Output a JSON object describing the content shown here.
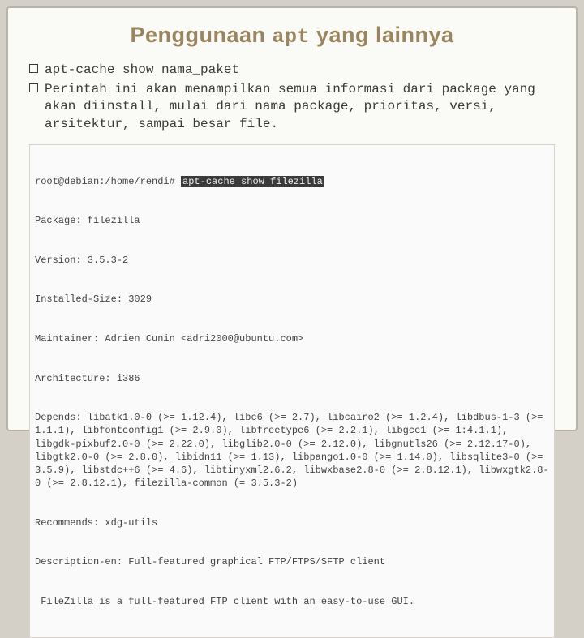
{
  "title": {
    "pre": "Penggunaan ",
    "mono": "apt",
    "post": " yang lainnya"
  },
  "bullets": [
    "apt-cache show nama_paket",
    "Perintah ini akan menampilkan semua informasi dari package yang akan diinstall, mulai dari nama package, prioritas, versi, arsitektur, sampai besar file."
  ],
  "terminal": {
    "prompt_prefix": "root@debian:/home/rendi# ",
    "command": "apt-cache show filezilla",
    "lines": [
      "Package: filezilla",
      "Version: 3.5.3-2",
      "Installed-Size: 3029",
      "Maintainer: Adrien Cunin <adri2000@ubuntu.com>",
      "Architecture: i386",
      "Depends: libatk1.0-0 (>= 1.12.4), libc6 (>= 2.7), libcairo2 (>= 1.2.4), libdbus-1-3 (>= 1.1.1), libfontconfig1 (>= 2.9.0), libfreetype6 (>= 2.2.1), libgcc1 (>= 1:4.1.1), libgdk-pixbuf2.0-0 (>= 2.22.0), libglib2.0-0 (>= 2.12.0), libgnutls26 (>= 2.12.17-0), libgtk2.0-0 (>= 2.8.0), libidn11 (>= 1.13), libpango1.0-0 (>= 1.14.0), libsqlite3-0 (>= 3.5.9), libstdc++6 (>= 4.6), libtinyxml2.6.2, libwxbase2.8-0 (>= 2.8.12.1), libwxgtk2.8-0 (>= 2.8.12.1), filezilla-common (= 3.5.3-2)",
      "Recommends: xdg-utils",
      "Description-en: Full-featured graphical FTP/FTPS/SFTP client",
      " FileZilla is a full-featured FTP client with an easy-to-use GUI."
    ]
  }
}
